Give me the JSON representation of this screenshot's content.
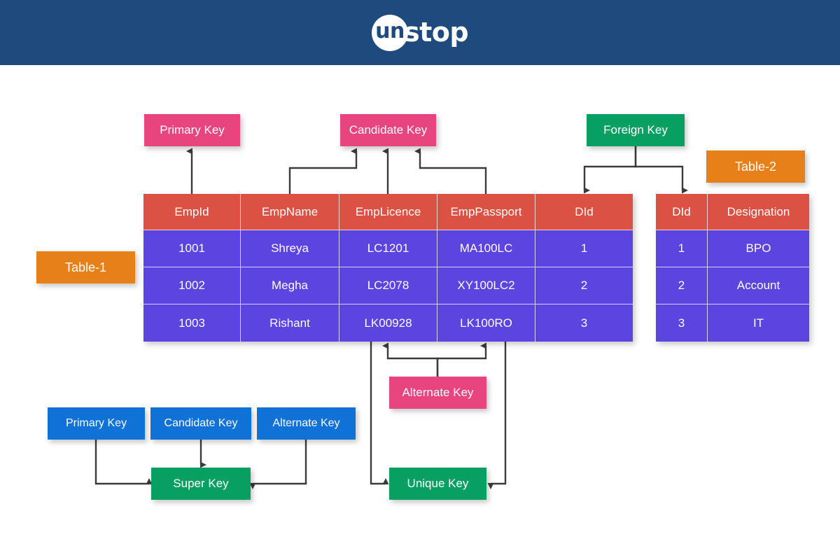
{
  "header": {
    "brand_un": "un",
    "brand_stop": "stop",
    "brand_full": "unstop",
    "background_color": "#1e4a7d"
  },
  "colors": {
    "pink": "#e8447e",
    "green": "#08a062",
    "orange": "#e8801a",
    "blue": "#1071d6",
    "table_header_red": "#db5244",
    "table_row_purple": "#5b44e0",
    "connector": "#3b3b3b",
    "page_background": "#ffffff"
  },
  "annotations": {
    "primary_key_top": "Primary Key",
    "candidate_key_top": "Candidate Key",
    "foreign_key": "Foreign Key",
    "alternate_key_mid": "Alternate Key",
    "table1_label": "Table-1",
    "table2_label": "Table-2"
  },
  "legend": {
    "primary_key": "Primary Key",
    "candidate_key": "Candidate Key",
    "alternate_key": "Alternate Key",
    "super_key": "Super Key",
    "unique_key": "Unique Key"
  },
  "table1": {
    "label": "Table-1",
    "columns": [
      "EmpId",
      "EmpName",
      "EmpLicence",
      "EmpPassport",
      "DId"
    ],
    "rows": [
      [
        "1001",
        "Shreya",
        "LC1201",
        "MA100LC",
        "1"
      ],
      [
        "1002",
        "Megha",
        "LC2078",
        "XY100LC2",
        "2"
      ],
      [
        "1003",
        "Rishant",
        "LK00928",
        "LK100RO",
        "3"
      ]
    ]
  },
  "table2": {
    "label": "Table-2",
    "columns": [
      "DId",
      "Designation"
    ],
    "rows": [
      [
        "1",
        "BPO"
      ],
      [
        "2",
        "Account"
      ],
      [
        "3",
        "IT"
      ]
    ]
  }
}
